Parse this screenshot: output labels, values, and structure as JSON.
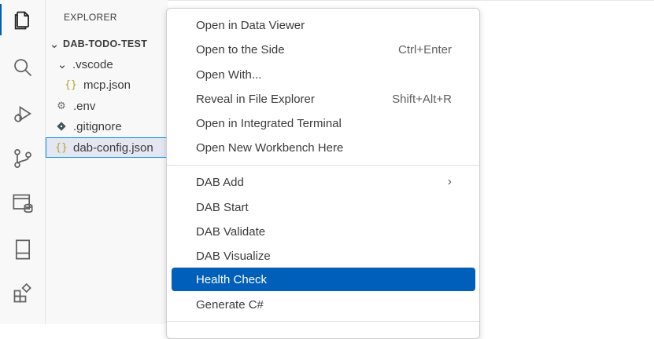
{
  "sidebar": {
    "title": "EXPLORER",
    "root": "DAB-TODO-TEST",
    "items": [
      {
        "label": ".vscode",
        "type": "folder"
      },
      {
        "label": "mcp.json",
        "type": "json"
      },
      {
        "label": ".env",
        "type": "gear"
      },
      {
        "label": ".gitignore",
        "type": "git"
      },
      {
        "label": "dab-config.json",
        "type": "json"
      }
    ]
  },
  "activity_bar": [
    "explorer-icon",
    "search-icon",
    "run-debug-icon",
    "source-control-icon",
    "database-icon",
    "layout-icon",
    "extensions-icon"
  ],
  "menu": {
    "group1": [
      {
        "label": "Open in Data Viewer",
        "shortcut": ""
      },
      {
        "label": "Open to the Side",
        "shortcut": "Ctrl+Enter"
      },
      {
        "label": "Open With...",
        "shortcut": ""
      },
      {
        "label": "Reveal in File Explorer",
        "shortcut": "Shift+Alt+R"
      },
      {
        "label": "Open in Integrated Terminal",
        "shortcut": ""
      },
      {
        "label": "Open New Workbench Here",
        "shortcut": ""
      }
    ],
    "group2": [
      {
        "label": "DAB Add",
        "shortcut": "›"
      },
      {
        "label": "DAB Start",
        "shortcut": ""
      },
      {
        "label": "DAB Validate",
        "shortcut": ""
      },
      {
        "label": "DAB Visualize",
        "shortcut": ""
      },
      {
        "label": "Health Check",
        "shortcut": ""
      },
      {
        "label": "Generate C#",
        "shortcut": ""
      }
    ]
  },
  "colors": {
    "accent": "#005fb8",
    "json_icon": "#b4a52a"
  }
}
